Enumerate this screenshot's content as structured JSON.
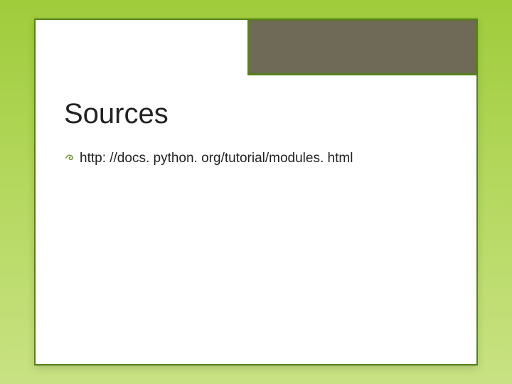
{
  "slide": {
    "title": "Sources",
    "bullets": [
      {
        "text": "http: //docs. python. org/tutorial/modules. html"
      }
    ]
  }
}
